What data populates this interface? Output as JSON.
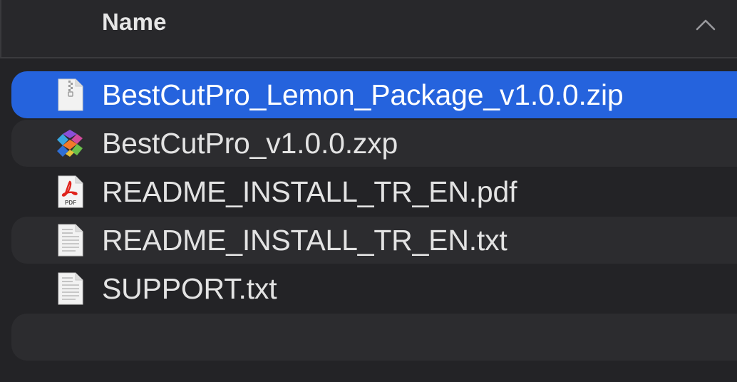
{
  "header": {
    "column_name": "Name",
    "sort_icon": "chevron-up-icon"
  },
  "files": [
    {
      "name": "BestCutPro_Lemon_Package_v1.0.0.zip",
      "icon": "zip-file-icon",
      "selected": true
    },
    {
      "name": "BestCutPro_v1.0.0.zxp",
      "icon": "zxp-extension-icon",
      "selected": false
    },
    {
      "name": "README_INSTALL_TR_EN.pdf",
      "icon": "pdf-file-icon",
      "selected": false,
      "icon_label": "PDF"
    },
    {
      "name": "README_INSTALL_TR_EN.txt",
      "icon": "text-file-icon",
      "selected": false
    },
    {
      "name": "SUPPORT.txt",
      "icon": "text-file-icon",
      "selected": false
    }
  ],
  "colors": {
    "background": "#232326",
    "alt_row": "#2c2c2f",
    "selection": "#2563dd",
    "text": "#e3e3e3"
  }
}
